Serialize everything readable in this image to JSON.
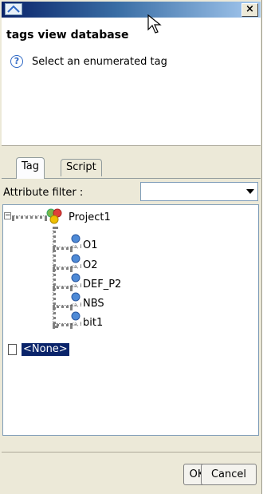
{
  "dialog": {
    "title": "tags view database",
    "message": "Select an enumerated tag",
    "close_glyph": "×",
    "help_glyph": "?"
  },
  "tabs": [
    {
      "label": "Tag",
      "active": true
    },
    {
      "label": "Script",
      "active": false
    }
  ],
  "filter": {
    "label": "Attribute filter :",
    "value": ""
  },
  "tree": {
    "root": {
      "label": "Project1",
      "expander": "−"
    },
    "children": [
      "O1",
      "O2",
      "DEF_P2",
      "NBS",
      "bit1"
    ],
    "none_item": "<None>"
  },
  "buttons": {
    "ok": "OK",
    "cancel": "Cancel"
  },
  "colors": {
    "selection": "#0a246a",
    "title_bar": "#0a246a",
    "dialog_bg": "#ece9d8"
  }
}
